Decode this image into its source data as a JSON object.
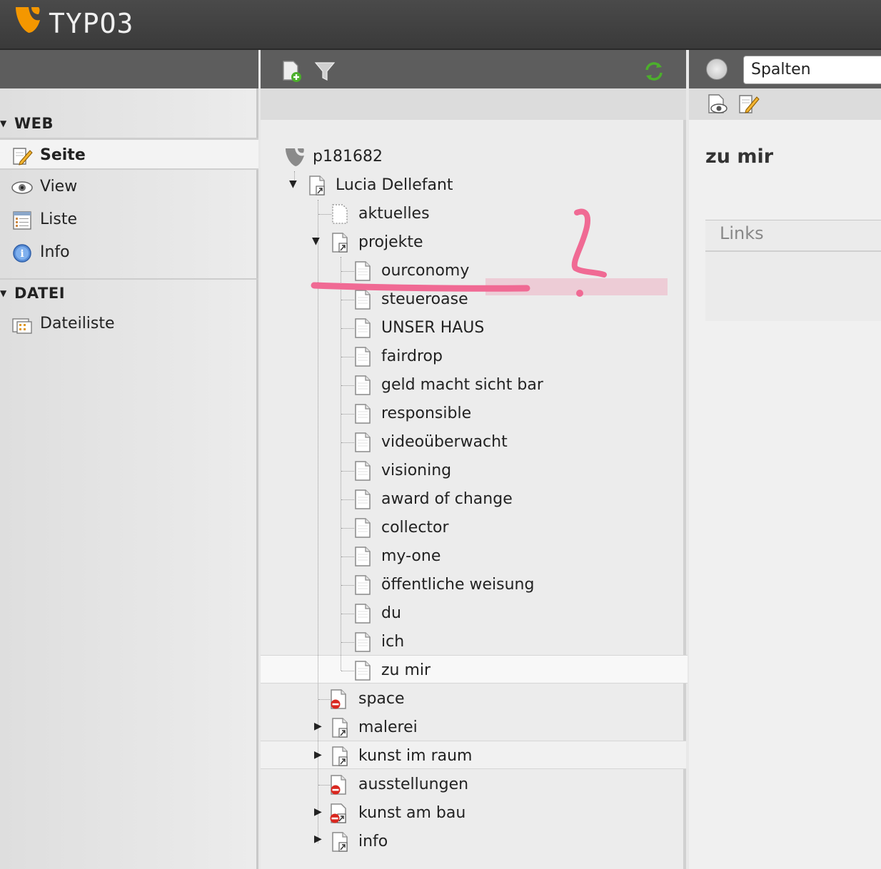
{
  "app": {
    "brand": "TYPO3"
  },
  "module_menu": {
    "groups": [
      {
        "title": "WEB",
        "items": [
          {
            "label": "Seite",
            "icon": "page-edit-icon",
            "active": true
          },
          {
            "label": "View",
            "icon": "eye-icon"
          },
          {
            "label": "Liste",
            "icon": "list-icon"
          },
          {
            "label": "Info",
            "icon": "info-icon"
          }
        ]
      },
      {
        "title": "DATEI",
        "items": [
          {
            "label": "Dateiliste",
            "icon": "filelist-icon"
          }
        ]
      }
    ]
  },
  "page_tree": {
    "toolbar": {
      "new_page_icon": "new-page-icon",
      "filter_icon": "filter-icon",
      "refresh_icon": "refresh-icon"
    },
    "root": "p181682",
    "site": "Lucia Dellefant",
    "nodes": [
      {
        "label": "aktuelles"
      },
      {
        "label": "projekte"
      },
      {
        "label": "ourconomy"
      },
      {
        "label": "steueroase"
      },
      {
        "label": "UNSER HAUS"
      },
      {
        "label": "fairdrop"
      },
      {
        "label": "geld macht sicht bar"
      },
      {
        "label": "responsible"
      },
      {
        "label": "videoüberwacht"
      },
      {
        "label": "visioning"
      },
      {
        "label": "award of change"
      },
      {
        "label": "collector"
      },
      {
        "label": "my-one"
      },
      {
        "label": "öffentliche weisung"
      },
      {
        "label": "du"
      },
      {
        "label": "ich"
      },
      {
        "label": "zu mir"
      },
      {
        "label": "space"
      },
      {
        "label": "malerei"
      },
      {
        "label": "kunst im raum"
      },
      {
        "label": "ausstellungen"
      },
      {
        "label": "kunst am bau"
      },
      {
        "label": "info"
      }
    ]
  },
  "content": {
    "columns_select": "Spalten",
    "page_title": "zu mir",
    "column_title": "Links"
  },
  "colors": {
    "header": "#3f3f3f",
    "annotation": "#f06a94"
  }
}
